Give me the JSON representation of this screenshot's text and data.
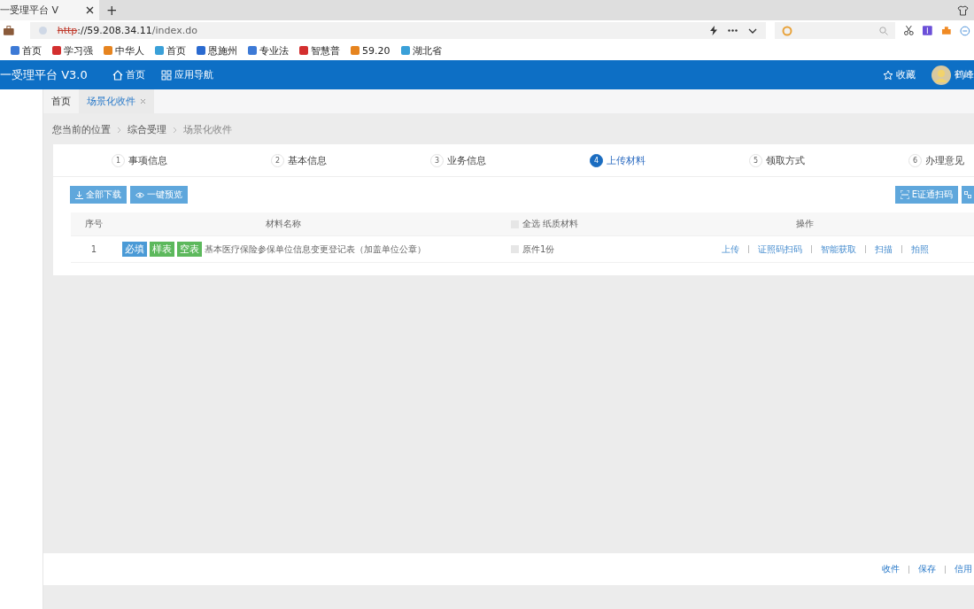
{
  "browser": {
    "tab_title": "一受理平台 V",
    "new_tab": "+",
    "url_scheme": "http",
    "url_host": "://59.208.34.11",
    "url_path": "/index.do",
    "bookmarks": [
      "首页",
      "学习强",
      "中华人",
      "首页",
      "恩施州",
      "专业法",
      "智慧普",
      "59.20",
      "湖北省"
    ]
  },
  "header": {
    "title": "一受理平台 V3.0",
    "nav": [
      "首页",
      "应用导航"
    ],
    "favorite": "收藏",
    "user": "鹤峰"
  },
  "page_tabs": [
    {
      "label": "首页",
      "selected": false,
      "closable": false
    },
    {
      "label": "场景化收件",
      "selected": true,
      "closable": true
    }
  ],
  "breadcrumb": [
    "您当前的位置",
    "综合受理",
    "场景化收件"
  ],
  "steps": [
    {
      "number": "1",
      "label": "事项信息",
      "selected": false
    },
    {
      "number": "2",
      "label": "基本信息",
      "selected": false
    },
    {
      "number": "3",
      "label": "业务信息",
      "selected": false
    },
    {
      "number": "4",
      "label": "上传材料",
      "selected": true
    },
    {
      "number": "5",
      "label": "领取方式",
      "selected": false
    },
    {
      "number": "6",
      "label": "办理意见",
      "selected": false
    }
  ],
  "toolbar": {
    "left": [
      "全部下载",
      "一键预览"
    ],
    "right": [
      "E证通扫码"
    ]
  },
  "table": {
    "columns": [
      "序号",
      "材料名称",
      "全选 纸质材料",
      "操作"
    ],
    "select_all_checked": false,
    "rows": [
      {
        "index": "1",
        "tags": [
          {
            "label": "必填",
            "color": "#4a9ad6"
          },
          {
            "label": "样表",
            "color": "#5cb85c"
          },
          {
            "label": "空表",
            "color": "#5cb85c"
          }
        ],
        "name": "基本医疗保险参保单位信息变更登记表（加盖单位公章）",
        "paper_checked": false,
        "paper": "原件1份",
        "actions": [
          "上传",
          "证照码扫码",
          "智能获取",
          "扫描",
          "拍照"
        ]
      }
    ]
  },
  "footer": [
    "收件",
    "保存",
    "信用"
  ]
}
